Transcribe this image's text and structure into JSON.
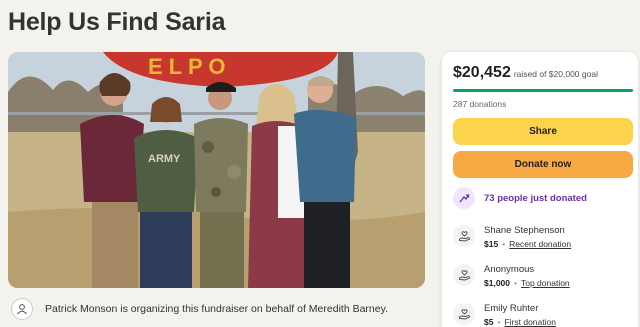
{
  "page": {
    "title": "Help Us Find Saria"
  },
  "organizer": {
    "text": "Patrick Monson is organizing this fundraiser on behalf of Meredith Barney."
  },
  "photo": {
    "banner_text": "E L P O"
  },
  "donation_panel": {
    "raised": "$20,452",
    "goal_text": "raised of $20,000 goal",
    "progress_fraction": 1.0,
    "donation_count": "287 donations",
    "share_label": "Share",
    "donate_label": "Donate now",
    "recent_activity": "73 people just donated",
    "donors": [
      {
        "name": "Shane Stephenson",
        "amount": "$15",
        "tag": "Recent donation"
      },
      {
        "name": "Anonymous",
        "amount": "$1,000",
        "tag": "Top donation"
      },
      {
        "name": "Emily Ruhter",
        "amount": "$5",
        "tag": "First donation"
      }
    ]
  },
  "colors": {
    "progress": "#02a95c",
    "share_button": "#fbd34d",
    "donate_button": "#f9a943",
    "recent_activity_text": "#6b2fa8"
  }
}
